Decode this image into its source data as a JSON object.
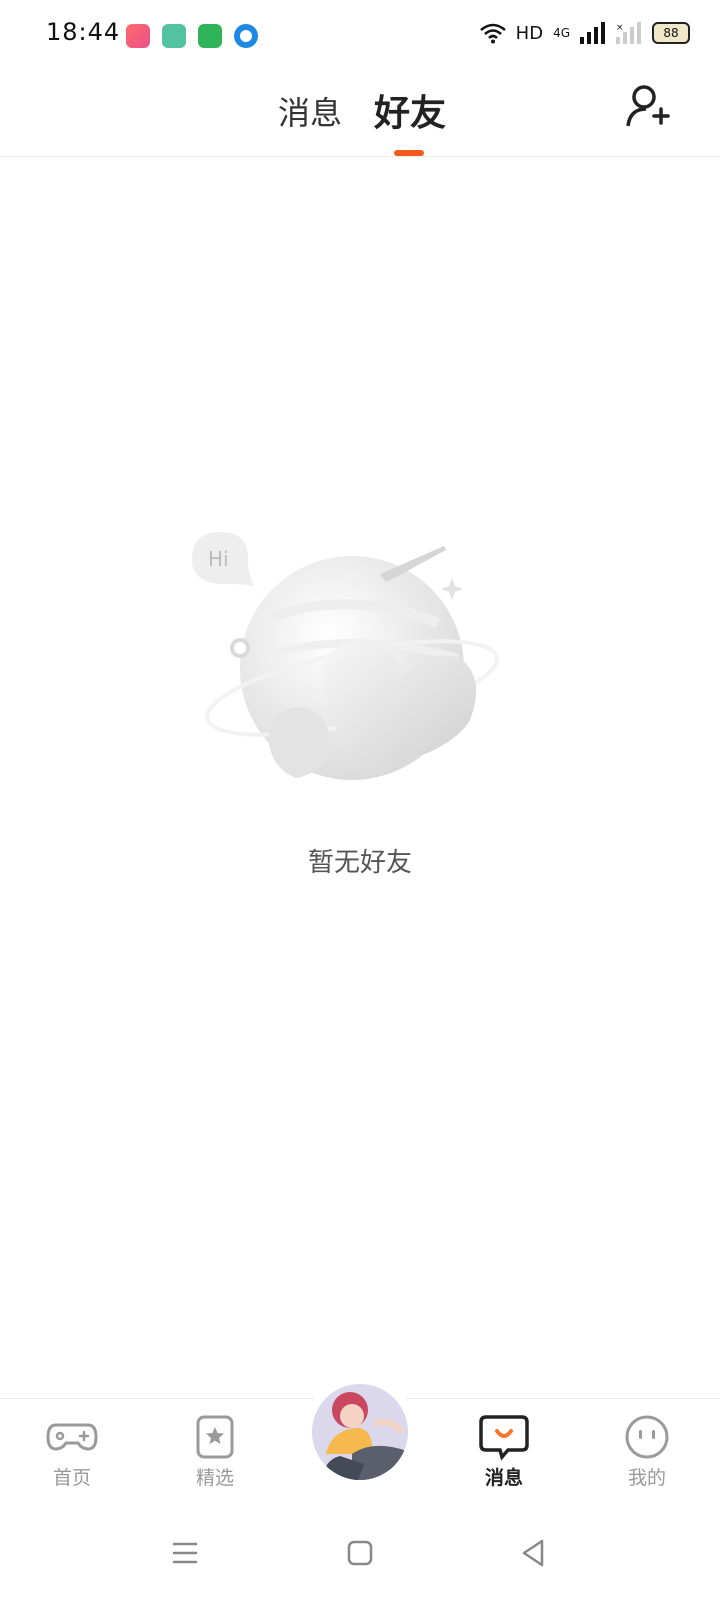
{
  "status_bar": {
    "time": "18:44",
    "network": "HD",
    "signal": "4G",
    "battery": "88",
    "app_icons": [
      "qq-icon",
      "gallery-icon",
      "store-icon",
      "app-dot-icon"
    ]
  },
  "header": {
    "tabs": [
      {
        "label": "消息",
        "active": false
      },
      {
        "label": "好友",
        "active": true
      }
    ]
  },
  "empty_state": {
    "hi_bubble": "Hi",
    "text": "暂无好友"
  },
  "bottom_nav": {
    "items": [
      {
        "label": "首页",
        "icon": "gamepad-icon",
        "active": false
      },
      {
        "label": "精选",
        "icon": "star-card-icon",
        "active": false
      },
      {
        "label": "消息",
        "icon": "chat-bubble-icon",
        "active": true
      },
      {
        "label": "我的",
        "icon": "face-icon",
        "active": false
      }
    ]
  },
  "colors": {
    "accent": "#f25a1e",
    "text_primary": "#222222",
    "text_secondary": "#9a9a9a"
  }
}
